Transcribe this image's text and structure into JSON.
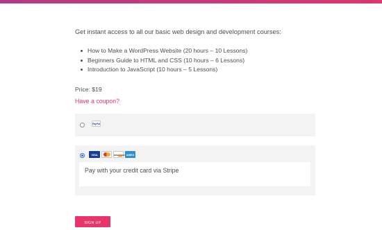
{
  "colors": {
    "accent": "#e3356f",
    "top_bar_start": "#b33a86",
    "top_bar_end": "#e0356e",
    "box_background": "#f3f3f3"
  },
  "intro_text": "Get instant access to all our basic web design and development courses:",
  "courses": [
    "How to Make a WordPress Website (20 hours – 10 Lessons)",
    "Beginners Guide to HTML and CSS (10 hours – 6 Lessons)",
    "Introduction to JavaScript (10 hours – 5 Lessons)"
  ],
  "price_text": "Price: $19",
  "coupon_link": "Have a coupon?",
  "payment": {
    "paypal": {
      "selected": false,
      "logo_text": "PayPal",
      "icon": "paypal-logo-icon"
    },
    "stripe": {
      "selected": true,
      "cards": [
        {
          "name": "visa",
          "label": "VISA",
          "icon": "visa-card-icon"
        },
        {
          "name": "mastercard",
          "label": "",
          "icon": "mastercard-icon"
        },
        {
          "name": "discover",
          "label": "DISCOVER",
          "icon": "discover-card-icon"
        },
        {
          "name": "amex",
          "label": "AMEX",
          "icon": "amex-card-icon"
        }
      ],
      "description": "Pay with your credit card via Stripe"
    }
  },
  "signup_button": "SIGN UP"
}
